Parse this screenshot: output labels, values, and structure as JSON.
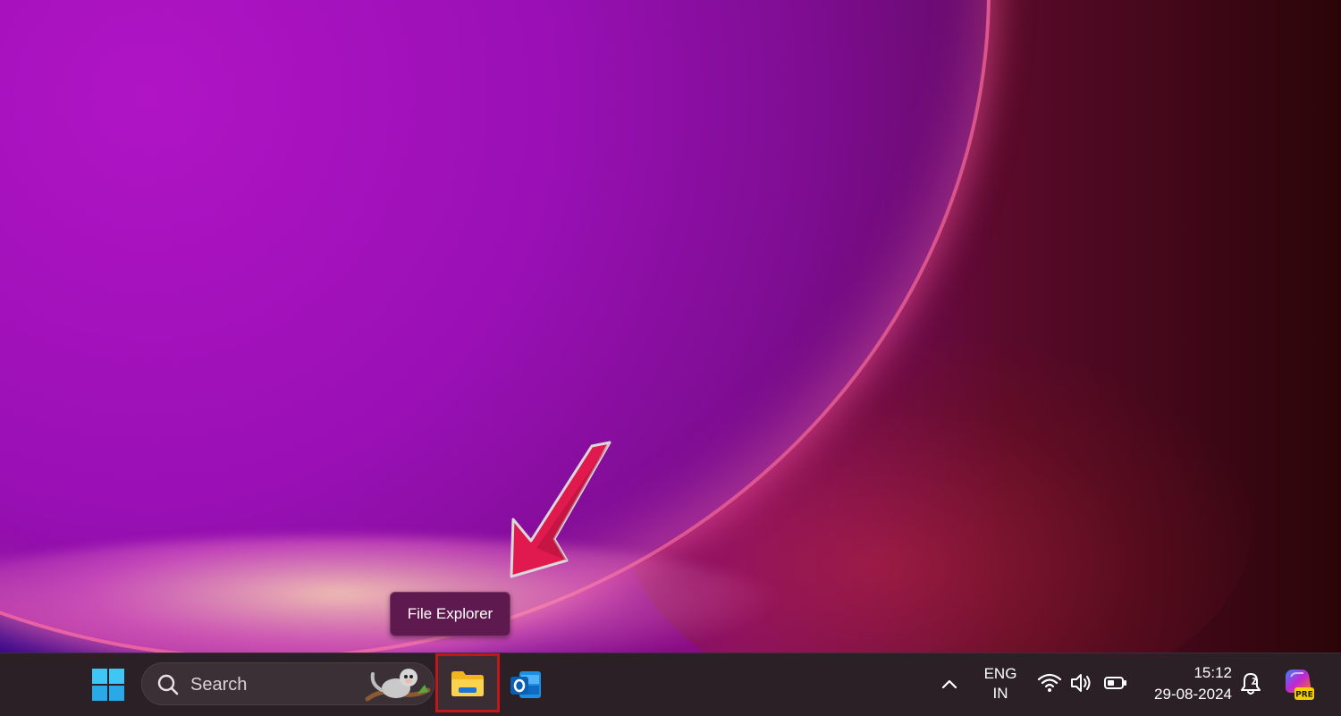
{
  "tooltip": {
    "text": "File Explorer"
  },
  "taskbar": {
    "search": {
      "label": "Search"
    },
    "apps": [
      {
        "name": "File Explorer",
        "icon": "folder-icon"
      },
      {
        "name": "Outlook",
        "icon": "outlook-icon"
      }
    ],
    "tray": {
      "language_line1": "ENG",
      "language_line2": "IN",
      "time": "15:12",
      "date": "29-08-2024",
      "copilot_badge": "PRE"
    }
  },
  "colors": {
    "highlight_box": "#c01818",
    "arrow": "#e01a4f",
    "taskbar_bg": "#2a2026",
    "tooltip_bg": "#5e1a4e"
  }
}
